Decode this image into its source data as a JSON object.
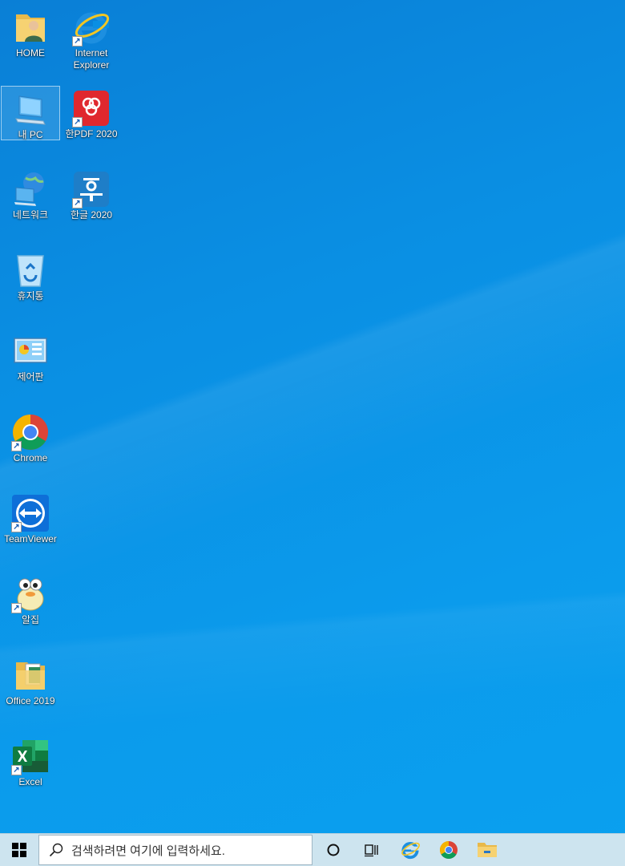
{
  "desktop": {
    "icons": [
      {
        "label": "HOME",
        "icon": "user-folder-icon",
        "shortcut": false
      },
      {
        "label": "Internet\nExplorer",
        "icon": "internet-explorer-icon",
        "shortcut": true
      },
      {
        "label": "내 PC",
        "icon": "computer-icon",
        "shortcut": false
      },
      {
        "label": "한PDF 2020",
        "icon": "hanpdf-icon",
        "shortcut": true
      },
      {
        "label": "네트워크",
        "icon": "network-icon",
        "shortcut": false
      },
      {
        "label": "한글 2020",
        "icon": "hangul-icon",
        "shortcut": true
      },
      {
        "label": "휴지통",
        "icon": "recycle-bin-icon",
        "shortcut": false
      },
      {
        "label": "제어판",
        "icon": "control-panel-icon",
        "shortcut": false
      },
      {
        "label": "Chrome",
        "icon": "chrome-icon",
        "shortcut": true
      },
      {
        "label": "TeamViewer",
        "icon": "teamviewer-icon",
        "shortcut": true
      },
      {
        "label": "알집",
        "icon": "alzip-icon",
        "shortcut": true
      },
      {
        "label": "Office 2019",
        "icon": "office-folder-icon",
        "shortcut": false
      },
      {
        "label": "Excel",
        "icon": "excel-icon",
        "shortcut": true
      }
    ],
    "shortcut_glyph": "↗"
  },
  "taskbar": {
    "search_placeholder": "검색하려면 여기에 입력하세요.",
    "pinned": [
      "internet-explorer-icon",
      "chrome-icon",
      "file-explorer-icon"
    ]
  },
  "colors": {
    "taskbar_bg": "#cde4ef",
    "desktop_bg": "#0a8fe3"
  }
}
